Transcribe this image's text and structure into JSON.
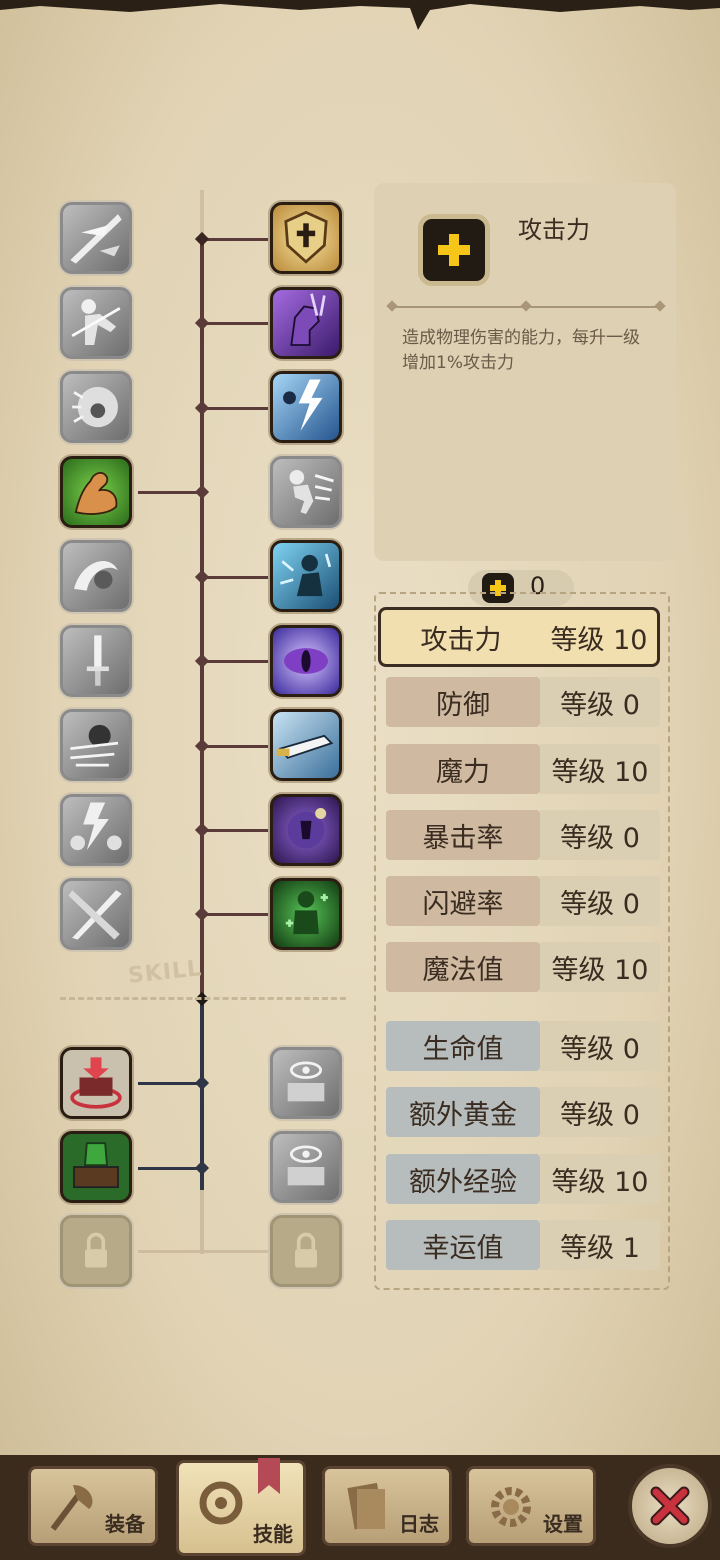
{
  "info": {
    "icon": "plus-icon",
    "title": "攻击力",
    "description": "造成物理伤害的能力，每升一级增加1%攻击力"
  },
  "points": {
    "icon": "plus-icon",
    "value": "0"
  },
  "stats": [
    {
      "name": "攻击力",
      "level": "等级 10",
      "group": "brown",
      "selected": true
    },
    {
      "name": "防御",
      "level": "等级 0",
      "group": "brown"
    },
    {
      "name": "魔力",
      "level": "等级 10",
      "group": "brown"
    },
    {
      "name": "暴击率",
      "level": "等级 0",
      "group": "brown"
    },
    {
      "name": "闪避率",
      "level": "等级 0",
      "group": "brown"
    },
    {
      "name": "魔法值",
      "level": "等级 10",
      "group": "brown"
    },
    {
      "name": "生命值",
      "level": "等级 0",
      "group": "blue"
    },
    {
      "name": "额外黄金",
      "level": "等级 0",
      "group": "blue"
    },
    {
      "name": "额外经验",
      "level": "等级 10",
      "group": "blue"
    },
    {
      "name": "幸运值",
      "level": "等级 1",
      "group": "blue"
    }
  ],
  "skill_section_label": "SKILL",
  "skill_tree": {
    "left": [
      "slash-skill-icon",
      "kick-skill-icon",
      "scream-skill-icon",
      "muscle-arm-skill-icon",
      "swirl-skill-icon",
      "dagger-skill-icon",
      "dash-skill-icon",
      "storm-skill-icon",
      "crossed-swords-skill-icon"
    ],
    "right": [
      "holy-shield-skill-icon",
      "purple-fist-skill-icon",
      "lightning-skill-icon",
      "sprint-skill-icon",
      "frost-skill-icon",
      "evil-eye-skill-icon",
      "sword-slash-skill-icon",
      "dark-orb-skill-icon",
      "clover-skill-icon"
    ],
    "bottom_left": [
      "red-chest-skill-icon",
      "green-chest-skill-icon",
      "locked-icon"
    ],
    "bottom_right": [
      "eye-chest-skill-icon",
      "eye-chest-skill-icon",
      "locked-icon"
    ]
  },
  "nav": {
    "equipment": "装备",
    "skills": "技能",
    "log": "日志",
    "settings": "设置",
    "close_icon": "close-icon"
  },
  "colors": {
    "selected_row": "#f1dfb0",
    "brown_row": "#cfb9a0",
    "blue_row": "#b7bcbd",
    "plus_yellow": "#f5c518",
    "close_red": "#c8323c"
  }
}
